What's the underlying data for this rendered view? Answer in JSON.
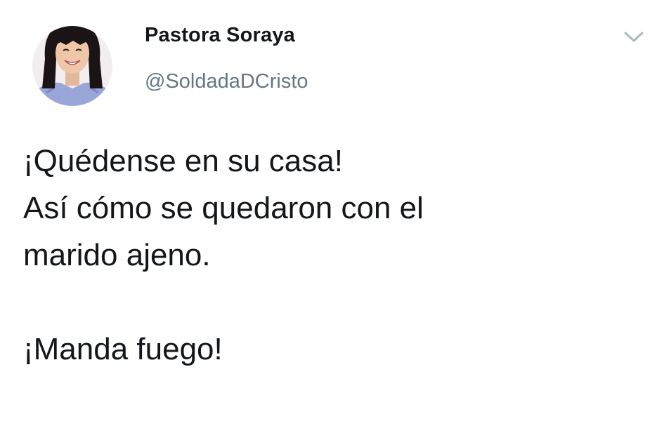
{
  "author": {
    "display_name": "Pastora Soraya",
    "handle": "@SoldadaDCristo",
    "avatar_icon": "profile-photo-avatar"
  },
  "menu": {
    "icon": "chevron-down-icon",
    "color": "#aab8c2"
  },
  "tweet": {
    "lines": [
      "¡Quédense en su casa!",
      "Así cómo se quedaron con el",
      "marido ajeno."
    ],
    "closing": "¡Manda fuego!"
  },
  "colors": {
    "text": "#14171a",
    "secondary_text": "#657786",
    "background": "#ffffff"
  }
}
